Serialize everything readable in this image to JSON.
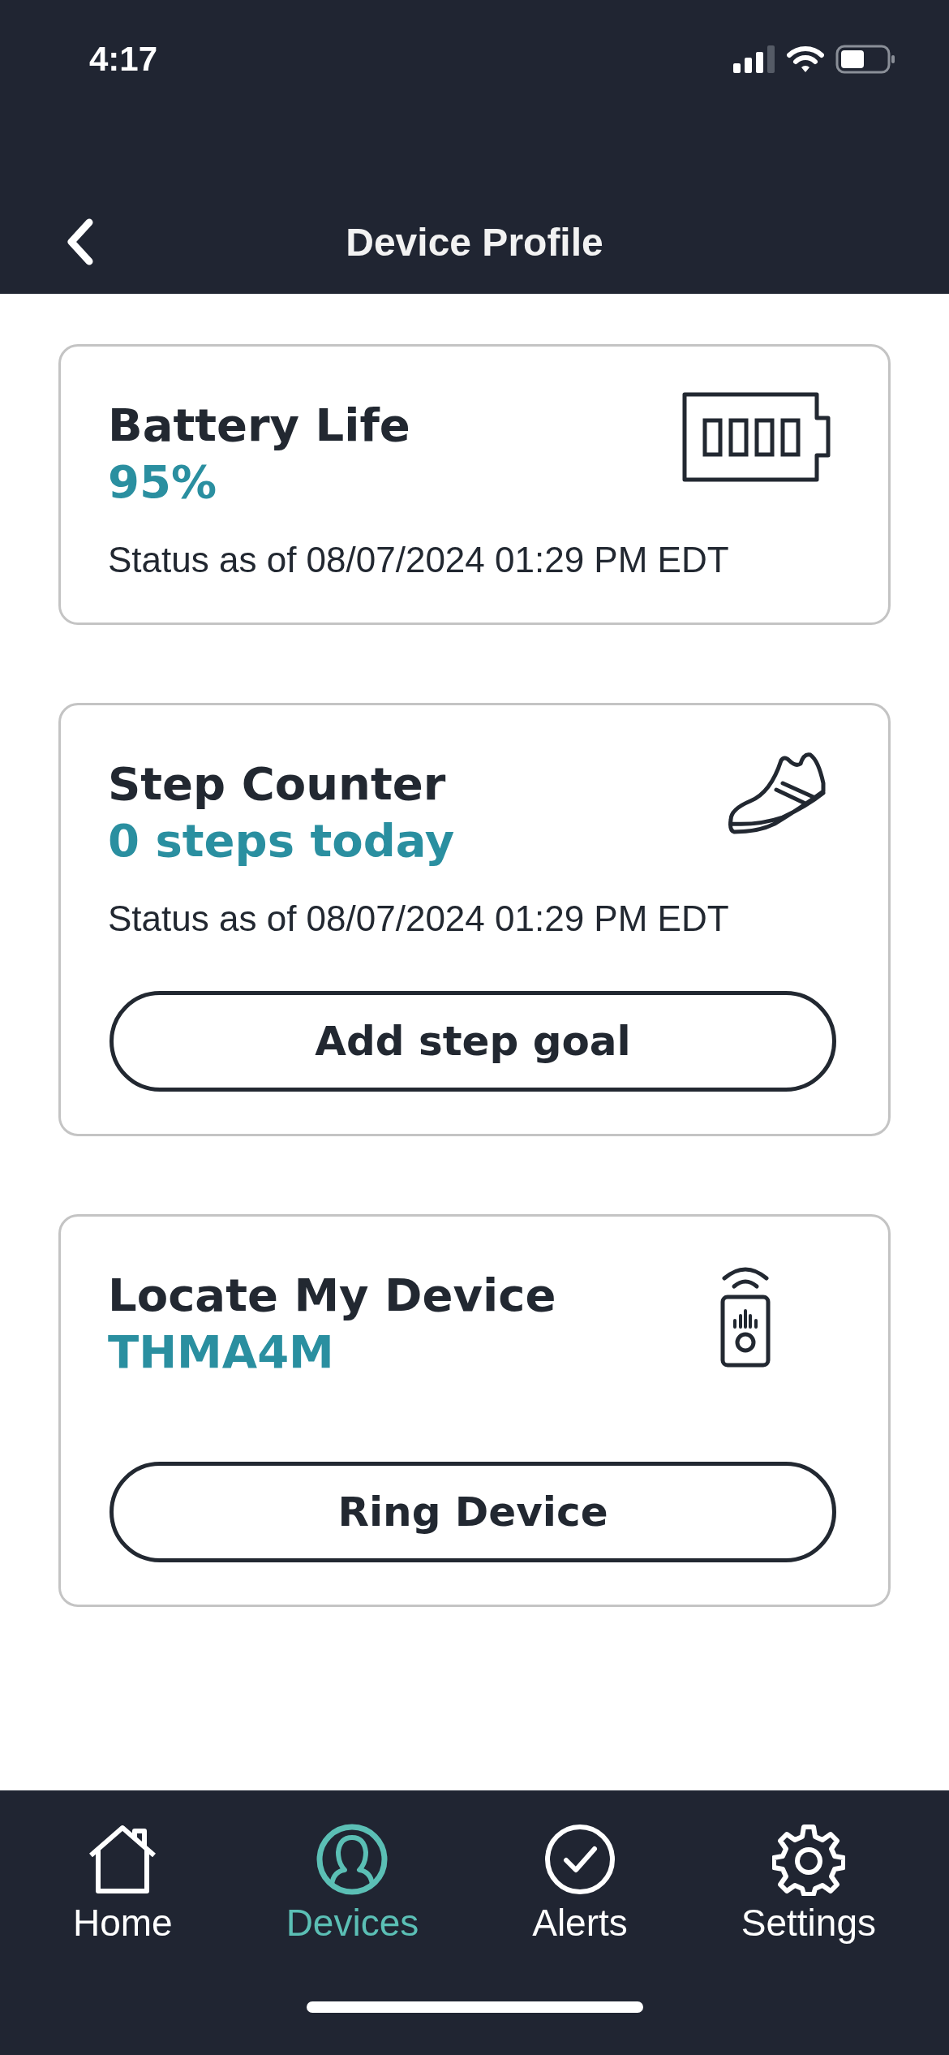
{
  "status_bar": {
    "time": "4:17"
  },
  "header": {
    "title": "Device Profile"
  },
  "cards": [
    {
      "kind": "battery",
      "title": "Battery Life",
      "value": "95%",
      "status": "Status as of 08/07/2024 01:29 PM EDT"
    },
    {
      "kind": "steps",
      "title": "Step Counter",
      "value": "0 steps today",
      "status": "Status as of 08/07/2024 01:29 PM EDT",
      "button": "Add step goal"
    },
    {
      "kind": "locate",
      "title": "Locate My Device",
      "value": "THMA4M",
      "button": "Ring Device"
    }
  ],
  "tabs": [
    {
      "kind": "home",
      "label": "Home",
      "selected": false
    },
    {
      "kind": "devices",
      "label": "Devices",
      "selected": true
    },
    {
      "kind": "alerts",
      "label": "Alerts",
      "selected": false
    },
    {
      "kind": "settings",
      "label": "Settings",
      "selected": false
    }
  ]
}
